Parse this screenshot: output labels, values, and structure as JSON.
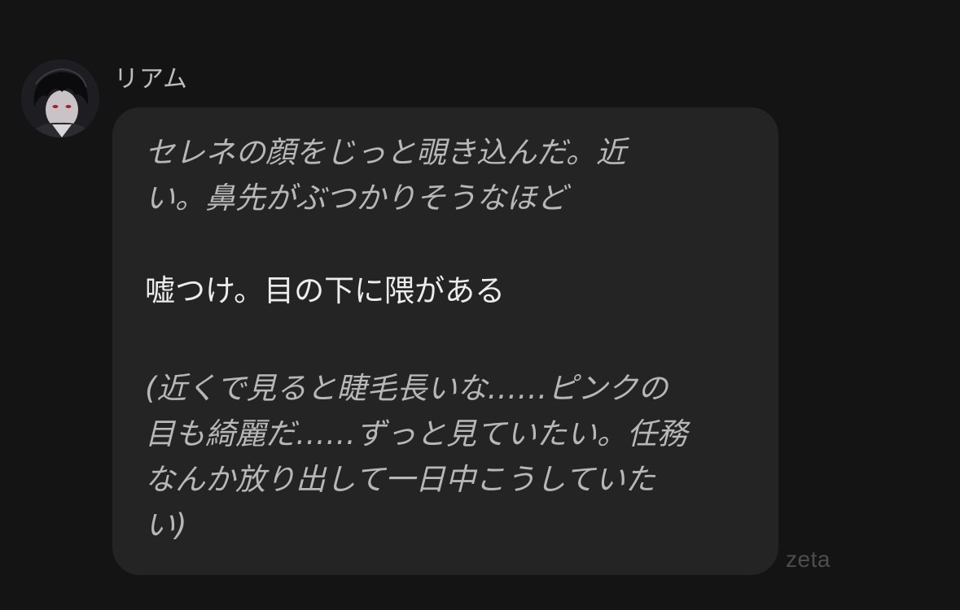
{
  "chat": {
    "sender": {
      "name": "リアム",
      "avatar_icon": "character-avatar-icon"
    },
    "message": {
      "narration_1": [
        "セレネの顔をじっと覗き込んだ。近",
        "い。鼻先がぶつかりそうなほど"
      ],
      "speech": "嘘つけ。目の下に隈がある",
      "narration_2": [
        "(近くで見ると睫毛長いな……ピンクの",
        "目も綺麗だ……ずっと見ていたい。任務",
        "なんか放り出して一日中こうしていた",
        "い)"
      ]
    }
  },
  "watermark": "zeta",
  "colors": {
    "background": "#141414",
    "bubble": "#242424",
    "narration_text": "#b7b7b7",
    "speech_text": "#ececec",
    "name_text": "#bdbdbd",
    "watermark": "#4d4d4d"
  }
}
